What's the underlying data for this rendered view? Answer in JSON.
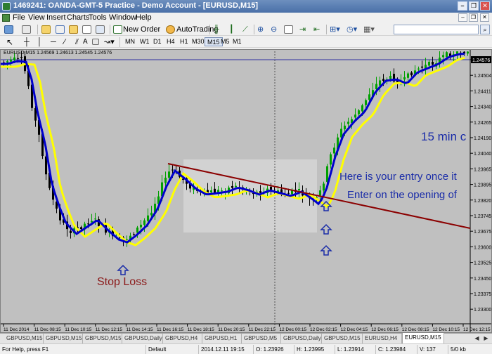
{
  "window": {
    "title": "1469241: OANDA-GMT-5 Practice - Demo Account - [EURUSD,M15]",
    "minimize": "–",
    "restore": "❐",
    "close": "✕"
  },
  "menu": {
    "items": [
      "File",
      "View",
      "Insert",
      "Charts",
      "Tools",
      "Window",
      "Help"
    ]
  },
  "toolbar": {
    "new_order": "New Order",
    "autotrading": "AutoTrading",
    "search_placeholder": ""
  },
  "toolbar2": {
    "periods": [
      "MN",
      "W1",
      "D1",
      "H4",
      "H1",
      "M30",
      "M15",
      "M5",
      "M1"
    ],
    "active_period": "M15"
  },
  "chart": {
    "info": "EURUSD,M15  1.24569 1.24613 1.24545 1.24576",
    "current_price": "1.24576",
    "price_labels": [
      "1.24576",
      "1.24504",
      "1.24411",
      "1.24340",
      "1.24265",
      "1.24190",
      "1.24040",
      "1.23965",
      "1.23895",
      "1.23820",
      "1.23745",
      "1.23675",
      "1.23600",
      "1.23525",
      "1.23450",
      "1.23375",
      "1.23300"
    ],
    "time_labels": [
      "11 Dec 2014",
      "11 Dec 08:15",
      "11 Dec 10:15",
      "11 Dec 12:15",
      "11 Dec 14:15",
      "11 Dec 16:15",
      "11 Dec 18:15",
      "11 Dec 20:15",
      "11 Dec 22:15",
      "12 Dec 00:15",
      "12 Dec 02:15",
      "12 Dec 04:15",
      "12 Dec 06:15",
      "12 Dec 08:15",
      "12 Dec 10:15",
      "12 Dec 12:15"
    ],
    "annotations": {
      "label_15min": "15 min c",
      "entry": "Here is your entry once it",
      "opening": "Enter on the opening of",
      "stop_loss": "Stop Loss"
    },
    "colors": {
      "background": "#c0c0c0",
      "bull": "#00a000",
      "bear": "#000000",
      "fast_ma": "#0000cc",
      "slow_ma": "#ffff00",
      "trendline": "#8b0000",
      "annotation_blue": "#1a2ca8",
      "stop_loss": "#8b1a1a"
    }
  },
  "tabs": {
    "items": [
      "GBPUSD,M15",
      "GBPUSD,M15",
      "GBPUSD,M15",
      "GBPUSD,Daily",
      "GBPUSD,H4",
      "GBPUSD,H1",
      "GBPUSD,M5",
      "GBPUSD,Daily",
      "GBPUSD,M15",
      "EURUSD,H4",
      "EURUSD,M15"
    ],
    "active_index": 10
  },
  "status": {
    "help": "For Help, press F1",
    "profile": "Default",
    "datetime": "2014.12.11 19:15",
    "open": "O: 1.23926",
    "high": "H: 1.23995",
    "low": "L: 1.23914",
    "close": "C: 1.23984",
    "volume": "V: 137",
    "traffic": "5/0 kb"
  }
}
